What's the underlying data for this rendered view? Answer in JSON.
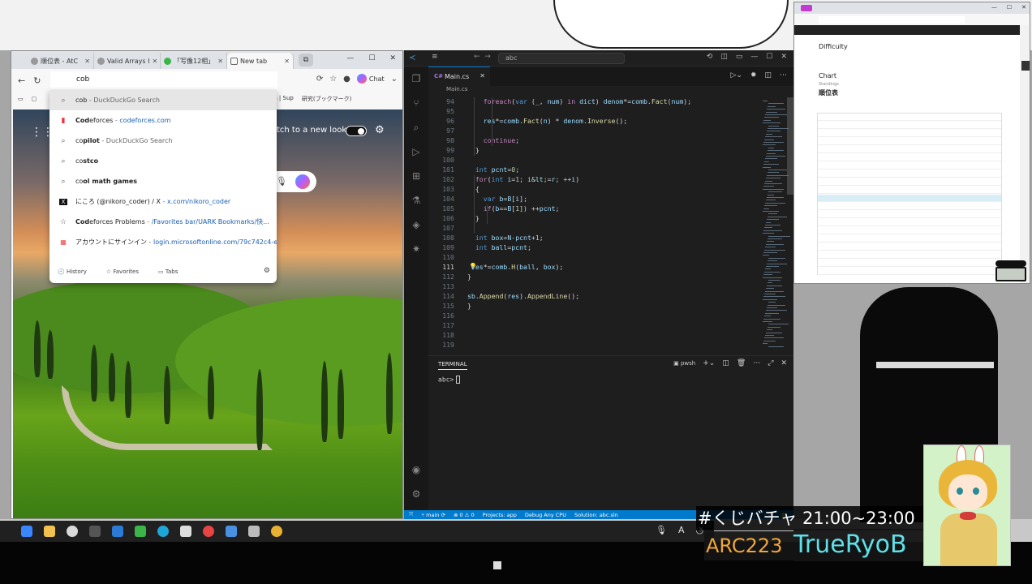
{
  "colors": {
    "vscode_blue": "#007acc",
    "accent_orange": "#f0a63a",
    "accent_cyan": "#5fe0e8"
  },
  "browser": {
    "tabs": [
      {
        "label": "順位表 - AtC",
        "icon": "atcoder-icon"
      },
      {
        "label": "Valid Arrays I",
        "icon": "atcoder-icon"
      },
      {
        "label": "「写像12相」",
        "icon": "green-dot-icon"
      },
      {
        "label": "New tab",
        "icon": "newtab-icon"
      }
    ],
    "address_value": "cob",
    "chat_label": "Chat",
    "favorites_right": [
      "ks | Sup",
      "研究(ブックマーク)"
    ],
    "suggestions": [
      {
        "icon": "search-icon",
        "html_bold": "",
        "text": "cob",
        "rest": " - DuckDuckGo Search",
        "url": ""
      },
      {
        "icon": "codeforces-icon",
        "bold": "Cod",
        "text": "eforces",
        "rest": " - ",
        "url": "codeforces.com"
      },
      {
        "icon": "search-icon",
        "bold": "co",
        "text": "pilot",
        "rest": " - DuckDuckGo Search",
        "url": ""
      },
      {
        "icon": "search-icon",
        "bold": "co",
        "text": "stco",
        "rest": "",
        "url": ""
      },
      {
        "icon": "search-icon",
        "bold": "co",
        "text": "ol math games",
        "rest": "",
        "url": ""
      },
      {
        "icon": "x-icon",
        "bold": "",
        "text": "にころ (@nikoro_coder) / X",
        "rest": " - ",
        "url": "x.com/nikoro_coder"
      },
      {
        "icon": "star-icon",
        "bold": "Cod",
        "text": "eforces Problems",
        "rest": " - ",
        "url": "/Favorites bar/UARK Bookmarks/快..."
      },
      {
        "icon": "microsoft-icon",
        "bold": "",
        "text": "アカウントにサインイン",
        "rest": " - ",
        "url": "login.microsoftonline.com/79c742c4-e..."
      }
    ],
    "footer": {
      "history": "History",
      "favorites": "Favorites",
      "tabs": "Tabs"
    },
    "ntp_switch_label": "tch to a new look"
  },
  "vscode": {
    "search": "abc",
    "tab_label": "Main.cs",
    "breadcrumb": "Main.cs",
    "lines": [
      {
        "n": "94",
        "code": "    foreach(var (_, num) in dict) denom*=comb.Fact(num);"
      },
      {
        "n": "95",
        "code": ""
      },
      {
        "n": "96",
        "code": "    res*=comb.Fact(n) * denom.Inverse();"
      },
      {
        "n": "97",
        "code": ""
      },
      {
        "n": "98",
        "code": "    continue;"
      },
      {
        "n": "99",
        "code": "  }"
      },
      {
        "n": "100",
        "code": ""
      },
      {
        "n": "101",
        "code": "  int pcnt=0;"
      },
      {
        "n": "102",
        "code": "  for(int i=1; i<=r; ++i)"
      },
      {
        "n": "103",
        "code": "  {"
      },
      {
        "n": "104",
        "code": "    var b=B[i];"
      },
      {
        "n": "105",
        "code": "    if(b==B[1]) ++pcnt;"
      },
      {
        "n": "106",
        "code": "  }"
      },
      {
        "n": "107",
        "code": ""
      },
      {
        "n": "108",
        "code": "  int box=N-pcnt+1;"
      },
      {
        "n": "109",
        "code": "  int ball=pcnt;"
      },
      {
        "n": "110",
        "code": ""
      },
      {
        "n": "111",
        "code": " res*=comb.H(ball, box);"
      },
      {
        "n": "112",
        "code": "}"
      },
      {
        "n": "113",
        "code": ""
      },
      {
        "n": "114",
        "code": "sb.Append(res).AppendLine();"
      },
      {
        "n": "115",
        "code": "}"
      },
      {
        "n": "116",
        "code": ""
      },
      {
        "n": "117",
        "code": ""
      },
      {
        "n": "118",
        "code": ""
      },
      {
        "n": "119",
        "code": ""
      }
    ],
    "terminal_tab": "TERMINAL",
    "terminal_shell": "pwsh",
    "terminal_prompt": "abc>",
    "status": {
      "branch": "main",
      "problems": "0",
      "warnings": "0",
      "project": "Projects: app",
      "debug": "Debug Any CPU",
      "solution": "Solution: abc.sln",
      "lang": "C#"
    }
  },
  "mini_browser": {
    "difficulty_heading": "Difficulty",
    "chart_heading": "Chart",
    "sub": "Standings",
    "standings_title": "順位表"
  },
  "overlay": {
    "title": "#くじバチャ 21:00~23:00",
    "contest": "ARC223",
    "name": "TrueRyoB"
  }
}
